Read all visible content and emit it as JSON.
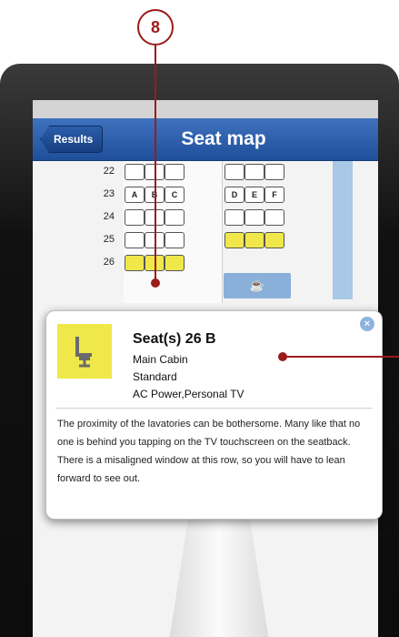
{
  "callout": {
    "number": "8"
  },
  "navbar": {
    "back_label": "Results",
    "title": "Seat map"
  },
  "seatmap": {
    "rows": [
      {
        "number": "22",
        "seats_left": [
          "",
          "",
          ""
        ],
        "seats_right": [
          "",
          "",
          ""
        ]
      },
      {
        "number": "23",
        "seats_left": [
          "A",
          "B",
          "C"
        ],
        "seats_right": [
          "D",
          "E",
          "F"
        ]
      },
      {
        "number": "24",
        "seats_left": [
          "",
          "",
          ""
        ],
        "seats_right": [
          "",
          "",
          ""
        ]
      },
      {
        "number": "25",
        "seats_left": [
          "",
          "",
          ""
        ],
        "seats_right": [
          "",
          "",
          ""
        ]
      },
      {
        "number": "26",
        "seats_left": [
          "",
          "",
          ""
        ],
        "seats_right": []
      }
    ],
    "galley_icon": "coffee-cup-icon"
  },
  "popover": {
    "title": "Seat(s) 26 B",
    "cabin": "Main Cabin",
    "seat_type": "Standard",
    "amenities": "AC Power,Personal TV",
    "description": "The proximity of the lavatories can be bothersome. Many like that no one is behind you tapping on the TV touchscreen on the seatback. There is a misaligned window at this row, so you will have to lean forward to see out.",
    "icon": "seat-icon",
    "close_icon": "close-icon"
  },
  "colors": {
    "selected_seat": "#f0e84a",
    "accent_callout": "#9b1b1b",
    "nav": "#2d5fae"
  }
}
